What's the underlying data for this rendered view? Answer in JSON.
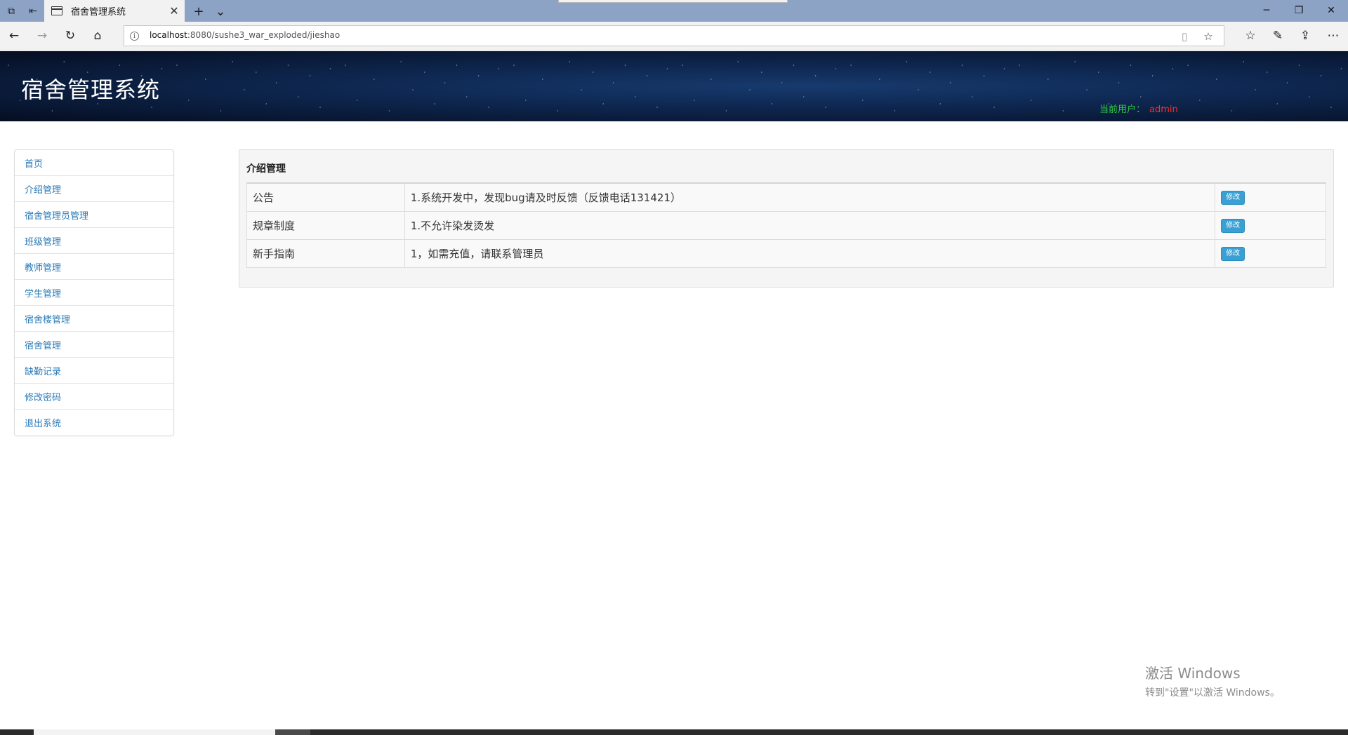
{
  "browser": {
    "tab_title": "宿舍管理系统",
    "url_host": "localhost",
    "url_rest": ":8080/sushe3_war_exploded/jieshao"
  },
  "header": {
    "app_title": "宿舍管理系统",
    "current_user_label": "当前用户：",
    "current_user_name": "admin"
  },
  "sidebar": {
    "items": [
      {
        "label": "首页"
      },
      {
        "label": "介绍管理"
      },
      {
        "label": "宿舍管理员管理"
      },
      {
        "label": "班级管理"
      },
      {
        "label": "教师管理"
      },
      {
        "label": "学生管理"
      },
      {
        "label": "宿舍楼管理"
      },
      {
        "label": "宿舍管理"
      },
      {
        "label": "缺勤记录"
      },
      {
        "label": "修改密码"
      },
      {
        "label": "退出系统"
      }
    ]
  },
  "main": {
    "panel_title": "介绍管理",
    "rows": [
      {
        "name": "公告",
        "content": "1.系统开发中，发现bug请及时反馈（反馈电话131421）",
        "action": "修改"
      },
      {
        "name": "规章制度",
        "content": "1.不允许染发烫发",
        "action": "修改"
      },
      {
        "name": "新手指南",
        "content": "1，如需充值，请联系管理员",
        "action": "修改"
      }
    ]
  },
  "watermark": {
    "title": "激活 Windows",
    "subtitle": "转到\"设置\"以激活 Windows。"
  },
  "icons": {
    "tab_actions": "tab-actions-icon",
    "set_aside": "set-aside-tabs-icon",
    "favicon": "page-favicon-icon",
    "close": "close-icon",
    "new_tab": "plus-icon",
    "tab_menu": "chevron-down-icon",
    "back": "arrow-left-icon",
    "forward": "arrow-right-icon",
    "refresh": "refresh-icon",
    "home": "home-icon",
    "info": "info-icon",
    "reading_view": "reading-view-icon",
    "favorite": "star-icon",
    "favorites_hub": "favorites-list-icon",
    "notes": "pen-icon",
    "share": "share-icon",
    "more": "more-icon"
  },
  "colors": {
    "link_blue": "#2a7ab8",
    "button_blue": "#3aa0d3",
    "user_label_green": "#2ecc40",
    "user_name_red": "#ff2a2a",
    "header_navy": "#0f2a55"
  }
}
